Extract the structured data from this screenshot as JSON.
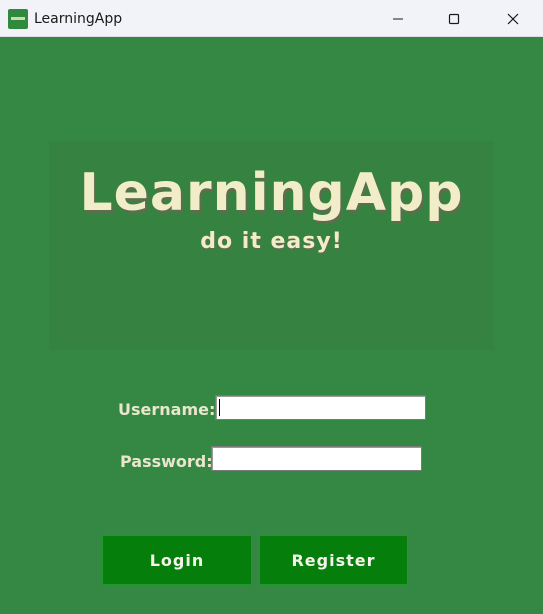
{
  "window": {
    "title": "LearningApp",
    "icon": "learningapp-logo-icon",
    "controls": [
      "minimize-icon",
      "maximize-icon",
      "close-icon"
    ]
  },
  "banner": {
    "title": "LearningApp",
    "subtitle": "do it easy!"
  },
  "form": {
    "username_label": "Username:",
    "username_value": "",
    "password_label": "Password:",
    "password_value": ""
  },
  "buttons": {
    "login_label": "Login",
    "register_label": "Register"
  },
  "colors": {
    "background": "#358744",
    "banner_text": "#f2edc9",
    "button_fill": "#067e0b",
    "titlebar": "#f2f3f8"
  }
}
